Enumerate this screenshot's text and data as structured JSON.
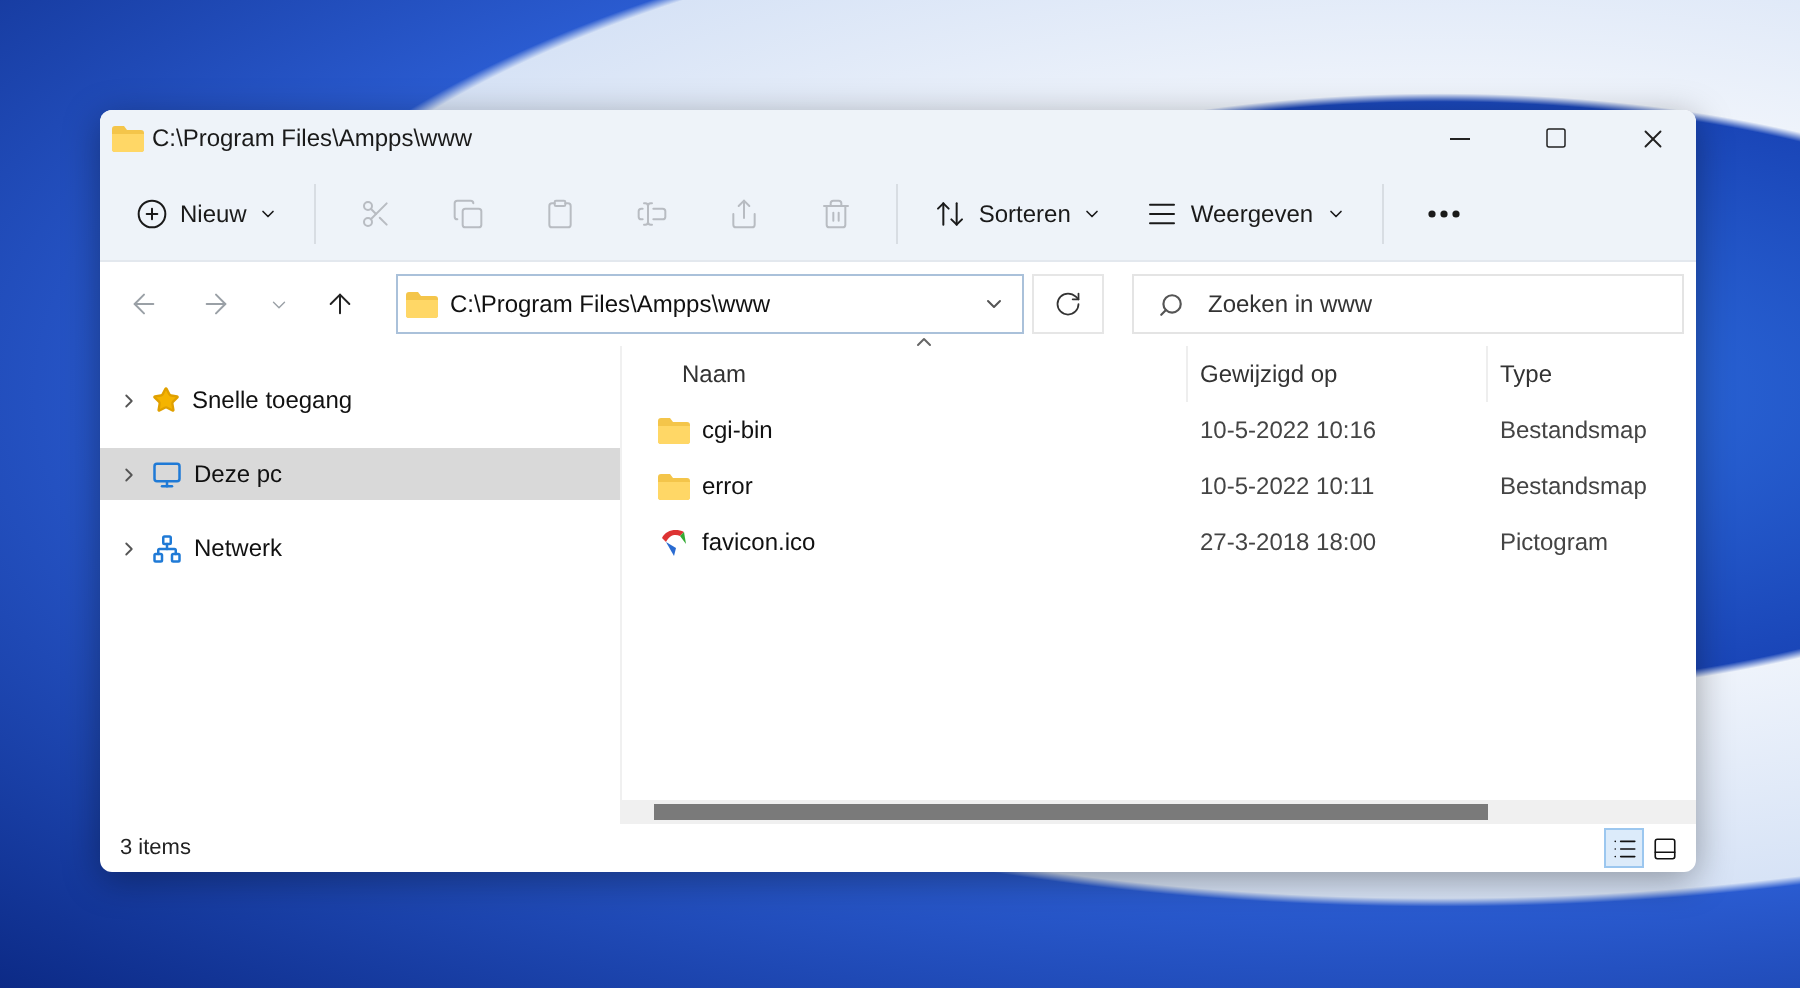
{
  "window": {
    "title": "C:\\Program Files\\Ampps\\www"
  },
  "toolbar": [
    {
      "kind": "menu",
      "label": "Nieuw",
      "disabled": false
    },
    {
      "kind": "icon",
      "disabled": true
    },
    {
      "kind": "icon",
      "disabled": true
    },
    {
      "kind": "icon",
      "disabled": true
    },
    {
      "kind": "icon",
      "disabled": true
    },
    {
      "kind": "icon",
      "disabled": true
    },
    {
      "kind": "icon",
      "disabled": true
    },
    {
      "kind": "menu",
      "label": "Sorteren",
      "disabled": false
    },
    {
      "kind": "menu",
      "label": "Weergeven",
      "disabled": false
    },
    {
      "kind": "more",
      "disabled": false
    }
  ],
  "navigation": [
    {
      "disabled": true
    },
    {
      "disabled": true
    },
    {
      "disabled": true
    },
    {
      "disabled": false
    }
  ],
  "address": {
    "value": "C:\\Program Files\\Ampps\\www"
  },
  "search": {
    "placeholder": "Zoeken in www"
  },
  "sidebar": {
    "items": [
      {
        "label": "Snelle toegang",
        "selected": false,
        "expanded": false
      },
      {
        "label": "Deze pc",
        "selected": true,
        "expanded": false
      },
      {
        "label": "Netwerk",
        "selected": false,
        "expanded": false
      }
    ]
  },
  "table": {
    "columns": [
      {
        "label": "Naam",
        "sorted": true
      },
      {
        "label": "Gewijzigd op",
        "sorted": false
      },
      {
        "label": "Type",
        "sorted": false
      }
    ],
    "rows": [
      {
        "kind": "folder",
        "name": "cgi-bin",
        "modified": "10-5-2022 10:16",
        "type": "Bestandsmap",
        "selected": false
      },
      {
        "kind": "folder",
        "name": "error",
        "modified": "10-5-2022 10:11",
        "type": "Bestandsmap",
        "selected": false
      },
      {
        "kind": "icon-file",
        "name": "favicon.ico",
        "modified": "27-3-2018 18:00",
        "type": "Pictogram",
        "selected": false
      }
    ]
  },
  "status_bar": {
    "count": "3 items",
    "views": [
      {
        "selected": true
      },
      {
        "selected": false
      }
    ]
  }
}
